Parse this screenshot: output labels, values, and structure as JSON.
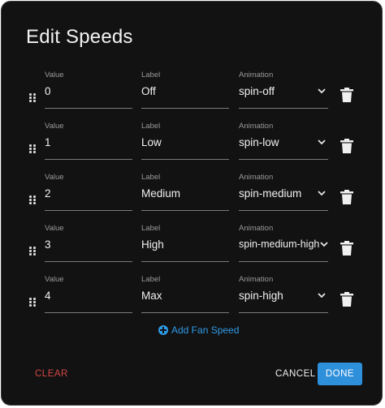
{
  "dialog": {
    "title": "Edit Speeds",
    "headers": {
      "value": "Value",
      "label": "Label",
      "animation": "Animation"
    },
    "speeds": [
      {
        "value": "0",
        "label": "Off",
        "animation": "spin-off"
      },
      {
        "value": "1",
        "label": "Low",
        "animation": "spin-low"
      },
      {
        "value": "2",
        "label": "Medium",
        "animation": "spin-medium"
      },
      {
        "value": "3",
        "label": "High",
        "animation": "spin-medium-high"
      },
      {
        "value": "4",
        "label": "Max",
        "animation": "spin-high"
      }
    ],
    "add_label": "Add Fan Speed",
    "clear_label": "CLEAR",
    "cancel_label": "CANCEL",
    "done_label": "DONE"
  },
  "colors": {
    "accent": "#2e8fdb",
    "danger": "#d64545",
    "background": "#121212"
  },
  "icons": [
    "drag-handle-icon",
    "chevron-down-icon",
    "trash-icon",
    "plus-circle-icon"
  ]
}
